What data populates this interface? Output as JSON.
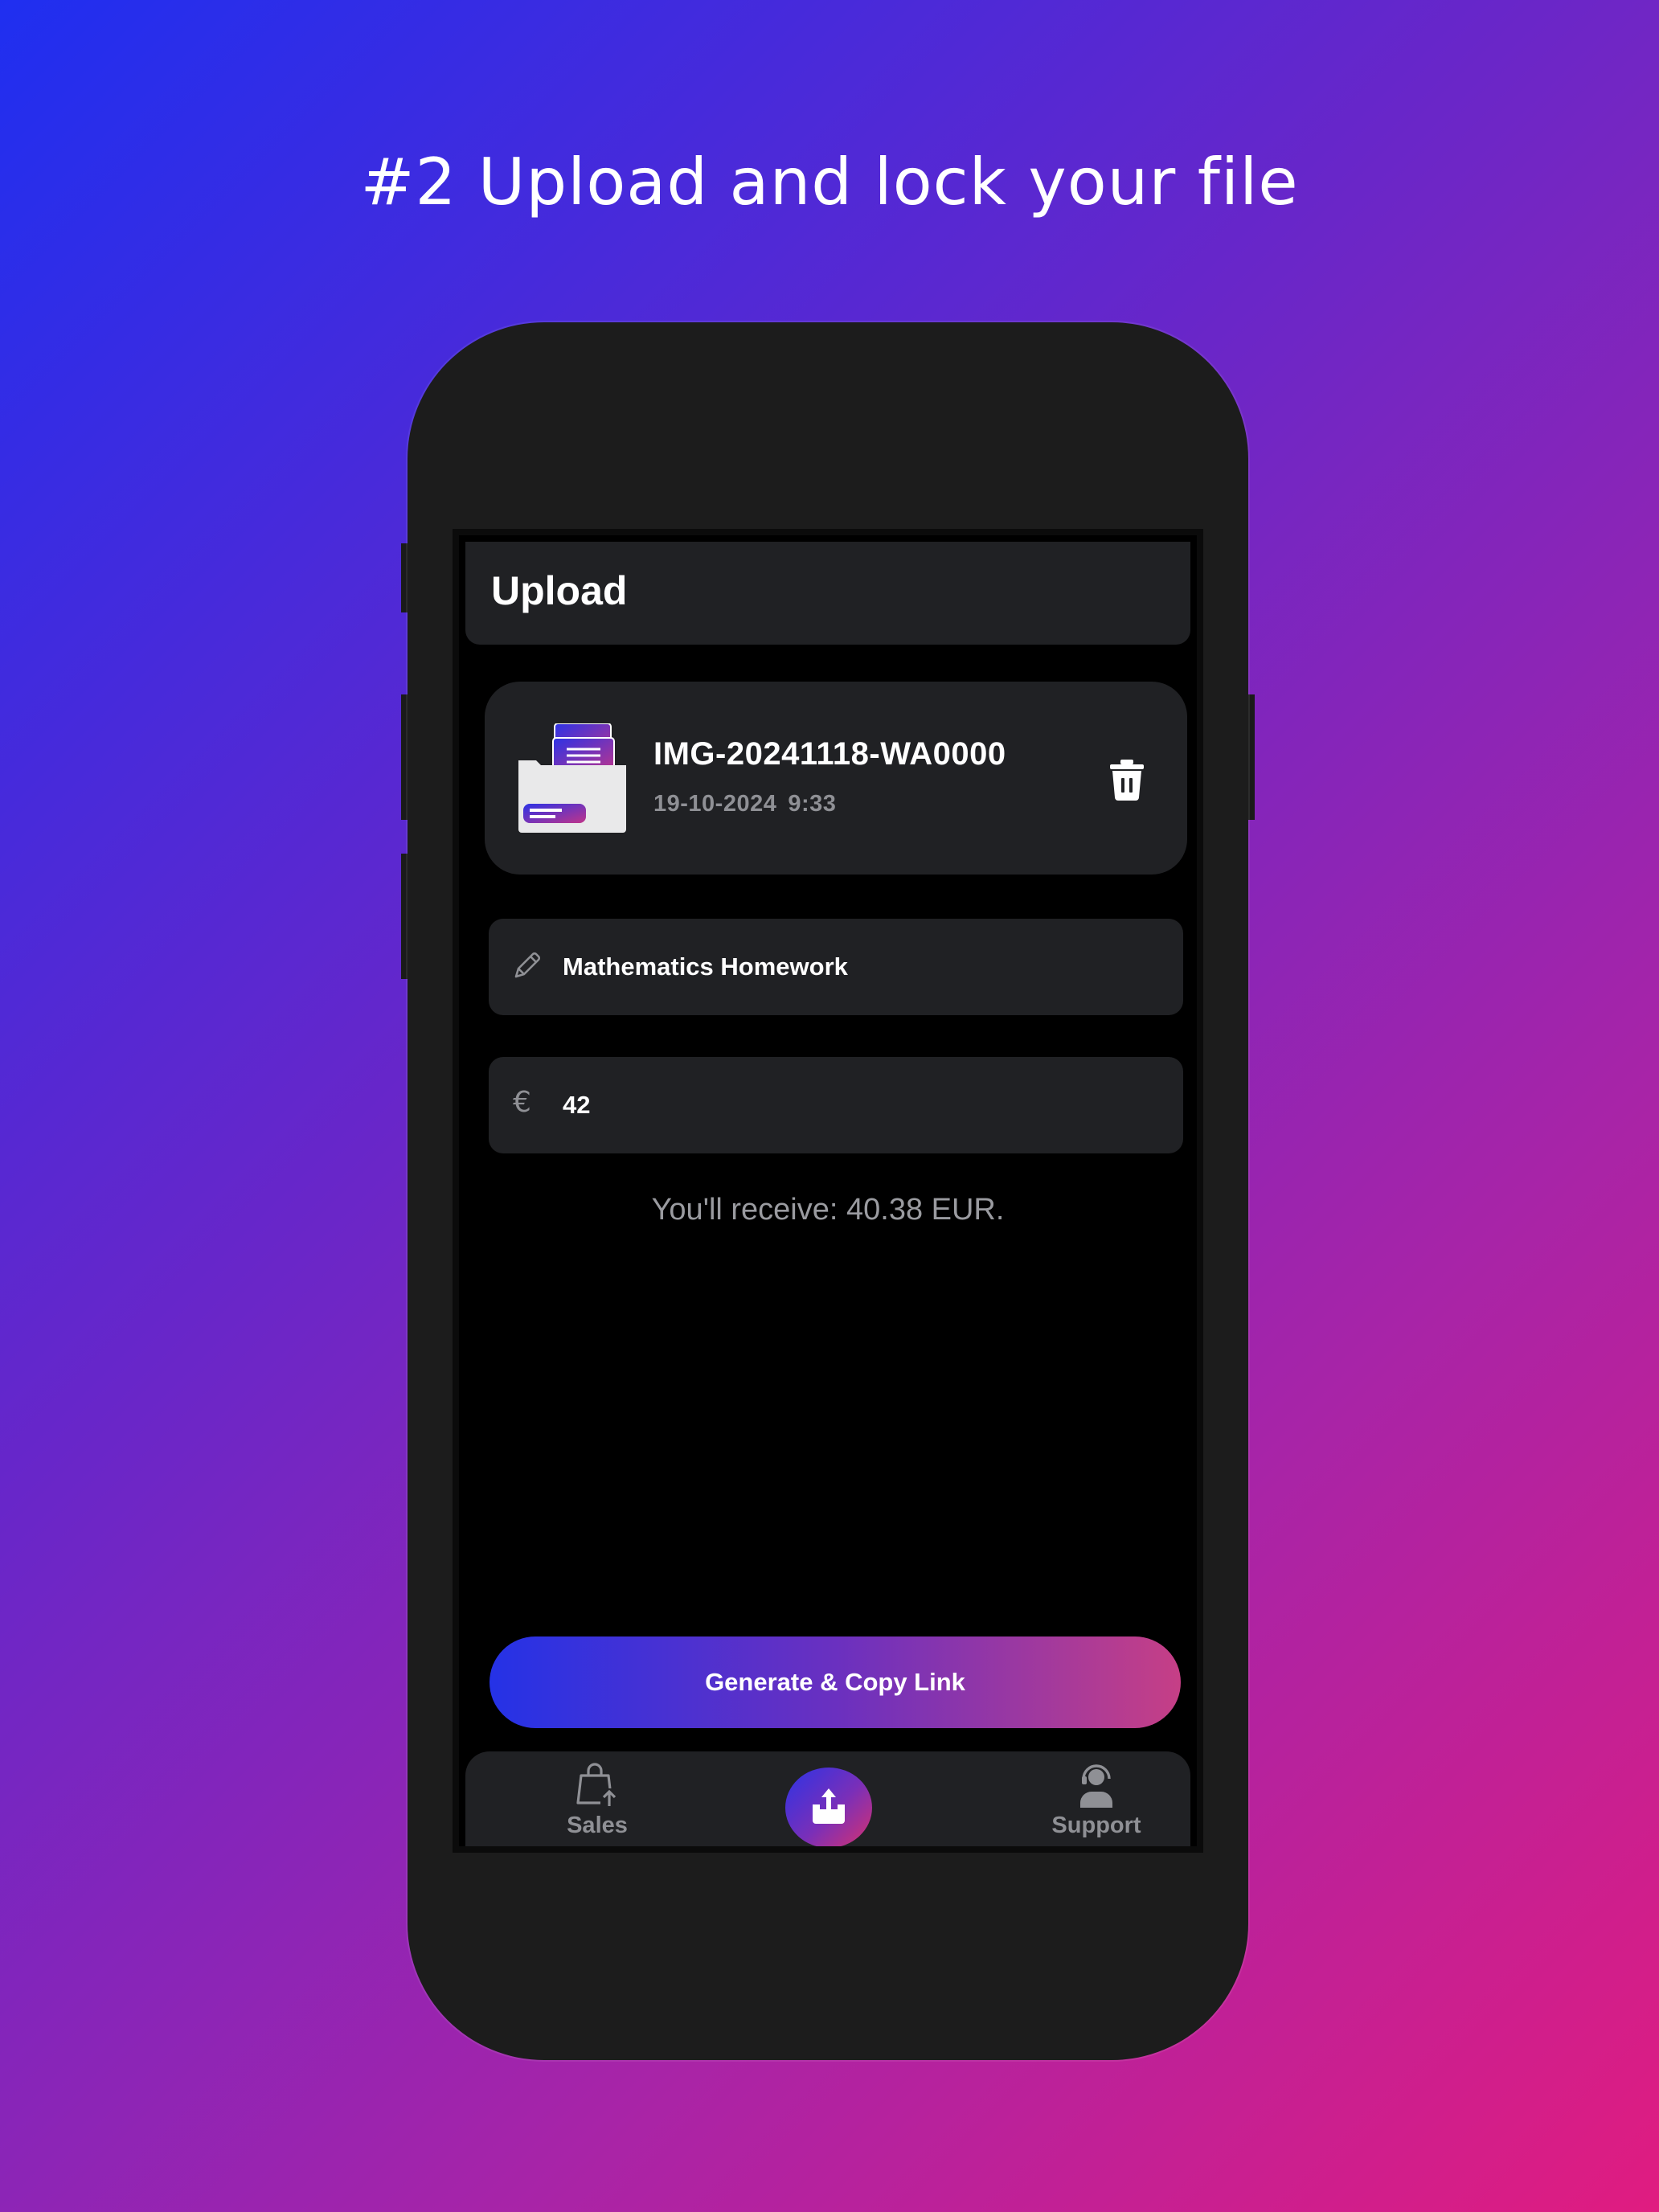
{
  "headline": "#2 Upload and lock your file",
  "appbar": {
    "title": "Upload"
  },
  "file": {
    "name": "IMG-20241118-WA0000",
    "date": "19-10-2024",
    "time": "9:33"
  },
  "title_field": {
    "icon": "pencil-icon",
    "value": "Mathematics Homework"
  },
  "price_field": {
    "icon": "euro-icon",
    "currency_symbol": "€",
    "value": "42"
  },
  "receive_text": "You'll receive: 40.38 EUR.",
  "cta": {
    "label": "Generate & Copy Link"
  },
  "bottom_nav": {
    "items": [
      {
        "label": "Sales",
        "icon": "shopping-bag-upload-icon"
      },
      {
        "label": "",
        "icon": "upload-icon",
        "active": true
      },
      {
        "label": "Support",
        "icon": "support-agent-icon"
      }
    ]
  },
  "colors": {
    "gradient_start": "#1f2ff0",
    "gradient_end": "#e01c80",
    "phone_body": "#1c1c1c",
    "card": "#202124",
    "muted_text": "#8f9095"
  }
}
